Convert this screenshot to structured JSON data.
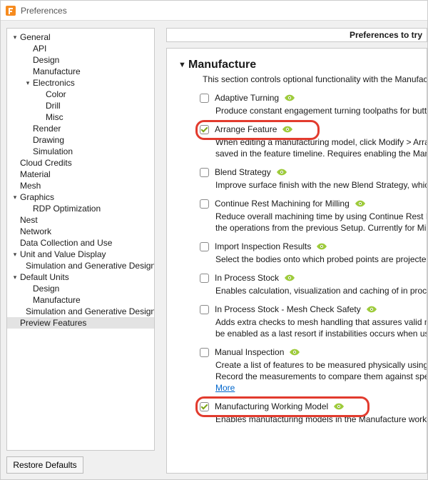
{
  "window": {
    "title": "Preferences"
  },
  "restore_label": "Restore Defaults",
  "header_right": "Preferences to try",
  "tree": [
    {
      "label": "General",
      "indent": 0,
      "twist": "▾"
    },
    {
      "label": "API",
      "indent": 1,
      "twist": ""
    },
    {
      "label": "Design",
      "indent": 1,
      "twist": ""
    },
    {
      "label": "Manufacture",
      "indent": 1,
      "twist": ""
    },
    {
      "label": "Electronics",
      "indent": 1,
      "twist": "▾"
    },
    {
      "label": "Color",
      "indent": 2,
      "twist": ""
    },
    {
      "label": "Drill",
      "indent": 2,
      "twist": ""
    },
    {
      "label": "Misc",
      "indent": 2,
      "twist": ""
    },
    {
      "label": "Render",
      "indent": 1,
      "twist": ""
    },
    {
      "label": "Drawing",
      "indent": 1,
      "twist": ""
    },
    {
      "label": "Simulation",
      "indent": 1,
      "twist": ""
    },
    {
      "label": "Cloud Credits",
      "indent": 0,
      "twist": ""
    },
    {
      "label": "Material",
      "indent": 0,
      "twist": ""
    },
    {
      "label": "Mesh",
      "indent": 0,
      "twist": ""
    },
    {
      "label": "Graphics",
      "indent": 0,
      "twist": "▾"
    },
    {
      "label": "RDP Optimization",
      "indent": 1,
      "twist": ""
    },
    {
      "label": "Nest",
      "indent": 0,
      "twist": ""
    },
    {
      "label": "Network",
      "indent": 0,
      "twist": ""
    },
    {
      "label": "Data Collection and Use",
      "indent": 0,
      "twist": ""
    },
    {
      "label": "Unit and Value Display",
      "indent": 0,
      "twist": "▾"
    },
    {
      "label": "Simulation and Generative Design",
      "indent": 1,
      "twist": ""
    },
    {
      "label": "Default Units",
      "indent": 0,
      "twist": "▾"
    },
    {
      "label": "Design",
      "indent": 1,
      "twist": ""
    },
    {
      "label": "Manufacture",
      "indent": 1,
      "twist": ""
    },
    {
      "label": "Simulation and Generative Design",
      "indent": 1,
      "twist": ""
    },
    {
      "label": "Preview Features",
      "indent": 0,
      "twist": "",
      "selected": true
    }
  ],
  "section": {
    "title": "Manufacture",
    "desc": "This section controls optional functionality with the Manufacture w"
  },
  "features": [
    {
      "label": "Adaptive Turning",
      "checked": false,
      "desc": "Produce constant engagement turning toolpaths for button style t"
    },
    {
      "label": "Arrange Feature",
      "checked": true,
      "callout": 1,
      "desc": "When editing a manufacturing model, click Modify > Arrange to cr",
      "desc2": "saved in the feature timeline. Requires enabling the Manufacturin"
    },
    {
      "label": "Blend Strategy",
      "checked": false,
      "desc": "Improve surface finish with the new Blend Strategy, which is driv"
    },
    {
      "label": "Continue Rest Machining for Milling",
      "checked": false,
      "desc": "Reduce overall machining time by using Continue Rest Machining t",
      "desc2": "the operations from the previous Setup. Currently for Milling only."
    },
    {
      "label": "Import Inspection Results",
      "checked": false,
      "desc": "Select the bodies onto which probed points are projected when im"
    },
    {
      "label": "In Process Stock",
      "checked": false,
      "desc": "Enables calculation, visualization and caching of in process stock w"
    },
    {
      "label": "In Process Stock - Mesh Check Safety",
      "checked": false,
      "desc": "Adds extra checks to mesh handling that assures valid mesh geom",
      "desc2": "be enabled as a last resort if instabilities occurs when using In Pro"
    },
    {
      "label": "Manual Inspection",
      "checked": false,
      "desc": "Create a list of features to be measured physically using a manual",
      "desc2": "Record the measurements to compare them against specified toler",
      "more": "More"
    },
    {
      "label": "Manufacturing Working Model",
      "checked": true,
      "callout": 2,
      "desc": "Enables manufacturing models in the Manufacture workspace. Rec"
    }
  ]
}
